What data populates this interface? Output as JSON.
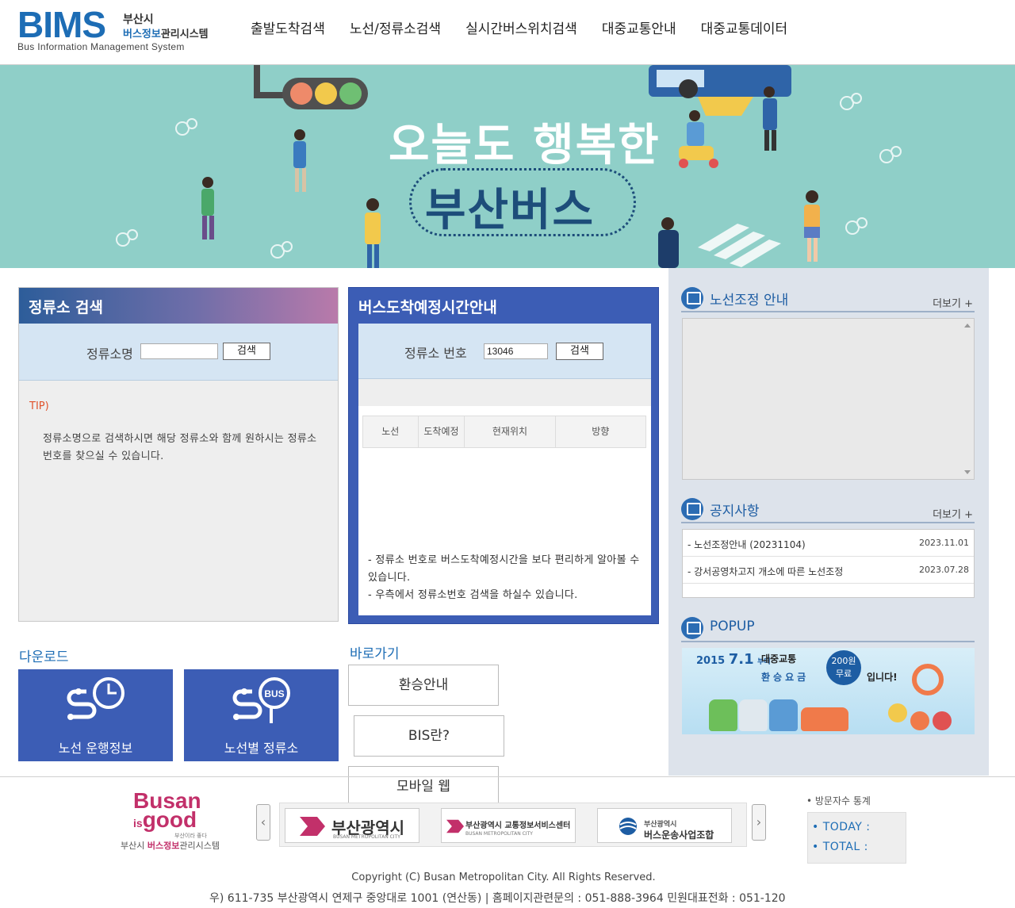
{
  "header": {
    "logo_text": "BIMS",
    "logo_city": "부산시",
    "logo_sys_blue": "버스정보",
    "logo_sys_rest": "관리시스템",
    "logo_en": "Bus Information Management System",
    "nav": [
      "출발도착검색",
      "노선/정류소검색",
      "실시간버스위치검색",
      "대중교통안내",
      "대중교통데이터"
    ]
  },
  "banner": {
    "line1": "오늘도 행복한",
    "line2": "부산버스"
  },
  "stop_search": {
    "title": "정류소 검색",
    "label": "정류소명",
    "value": "",
    "button": "검색",
    "tip_title": "TIP)",
    "tip_text": "정류소명으로 검색하시면 해당 정류소와 함께 원하시는 정류소 번호를 찾으실 수 있습니다."
  },
  "arrival": {
    "title": "버스도착예정시간안내",
    "label": "정류소 번호",
    "value": "13046",
    "button": "검색",
    "columns": [
      "노선",
      "도착예정",
      "현재위치",
      "방향"
    ],
    "note1": "- 정류소 번호로 버스도착예정시간을 보다 편리하게 알아볼 수 있습니다.",
    "note2": "- 우측에서 정류소번호 검색을 하실수 있습니다."
  },
  "route_adjust": {
    "title": "노선조정 안내",
    "more": "더보기 +"
  },
  "notice": {
    "title": "공지사항",
    "more": "더보기 +",
    "items": [
      {
        "title": "- 노선조정안내 (20231104)",
        "date": "2023.11.01"
      },
      {
        "title": "- 강서공영차고지 개소에 따른 노선조정",
        "date": "2023.07.28"
      }
    ]
  },
  "popup": {
    "title": "POPUP",
    "year": "2015",
    "date": "7.1",
    "from": "부터",
    "line_a": "대중교통",
    "line_b": "환승요금",
    "price": "200원",
    "free": "무료",
    "end": "입니다!"
  },
  "download": {
    "title": "다운로드",
    "items": [
      "노선 운행정보",
      "노선별 정류소"
    ],
    "bus_badge": "BUS"
  },
  "shortcuts": {
    "title": "바로가기",
    "items": [
      "환승안내",
      "BIS란?",
      "모바일 웹"
    ]
  },
  "footer": {
    "busan": "Busan",
    "is": "is",
    "good": "good",
    "slogan": "부산이라 좋다",
    "sys_prefix": "부산시 ",
    "sys_blue": "버스정보",
    "sys_rest": "관리시스템",
    "partners": [
      {
        "name": "부산광역시",
        "en": "BUSAN METROPOLITAN CITY"
      },
      {
        "name": "부산광역시 교통정보서비스센터",
        "en": "BUSAN METROPOLITAN CITY"
      },
      {
        "name": "부산광역시",
        "name2": "버스운송사업조합"
      }
    ],
    "stats_title": "• 방문자수 통계",
    "today": "• TODAY :",
    "total": "• TOTAL :",
    "copyright": "Copyright (C) Busan Metropolitan City. All Rights Reserved.",
    "address": "우) 611-735 부산광역시 연제구 중앙대로 1001 (연산동) | 홈페이지관련문의 : 051-888-3964 민원대표전화 : 051-120"
  }
}
